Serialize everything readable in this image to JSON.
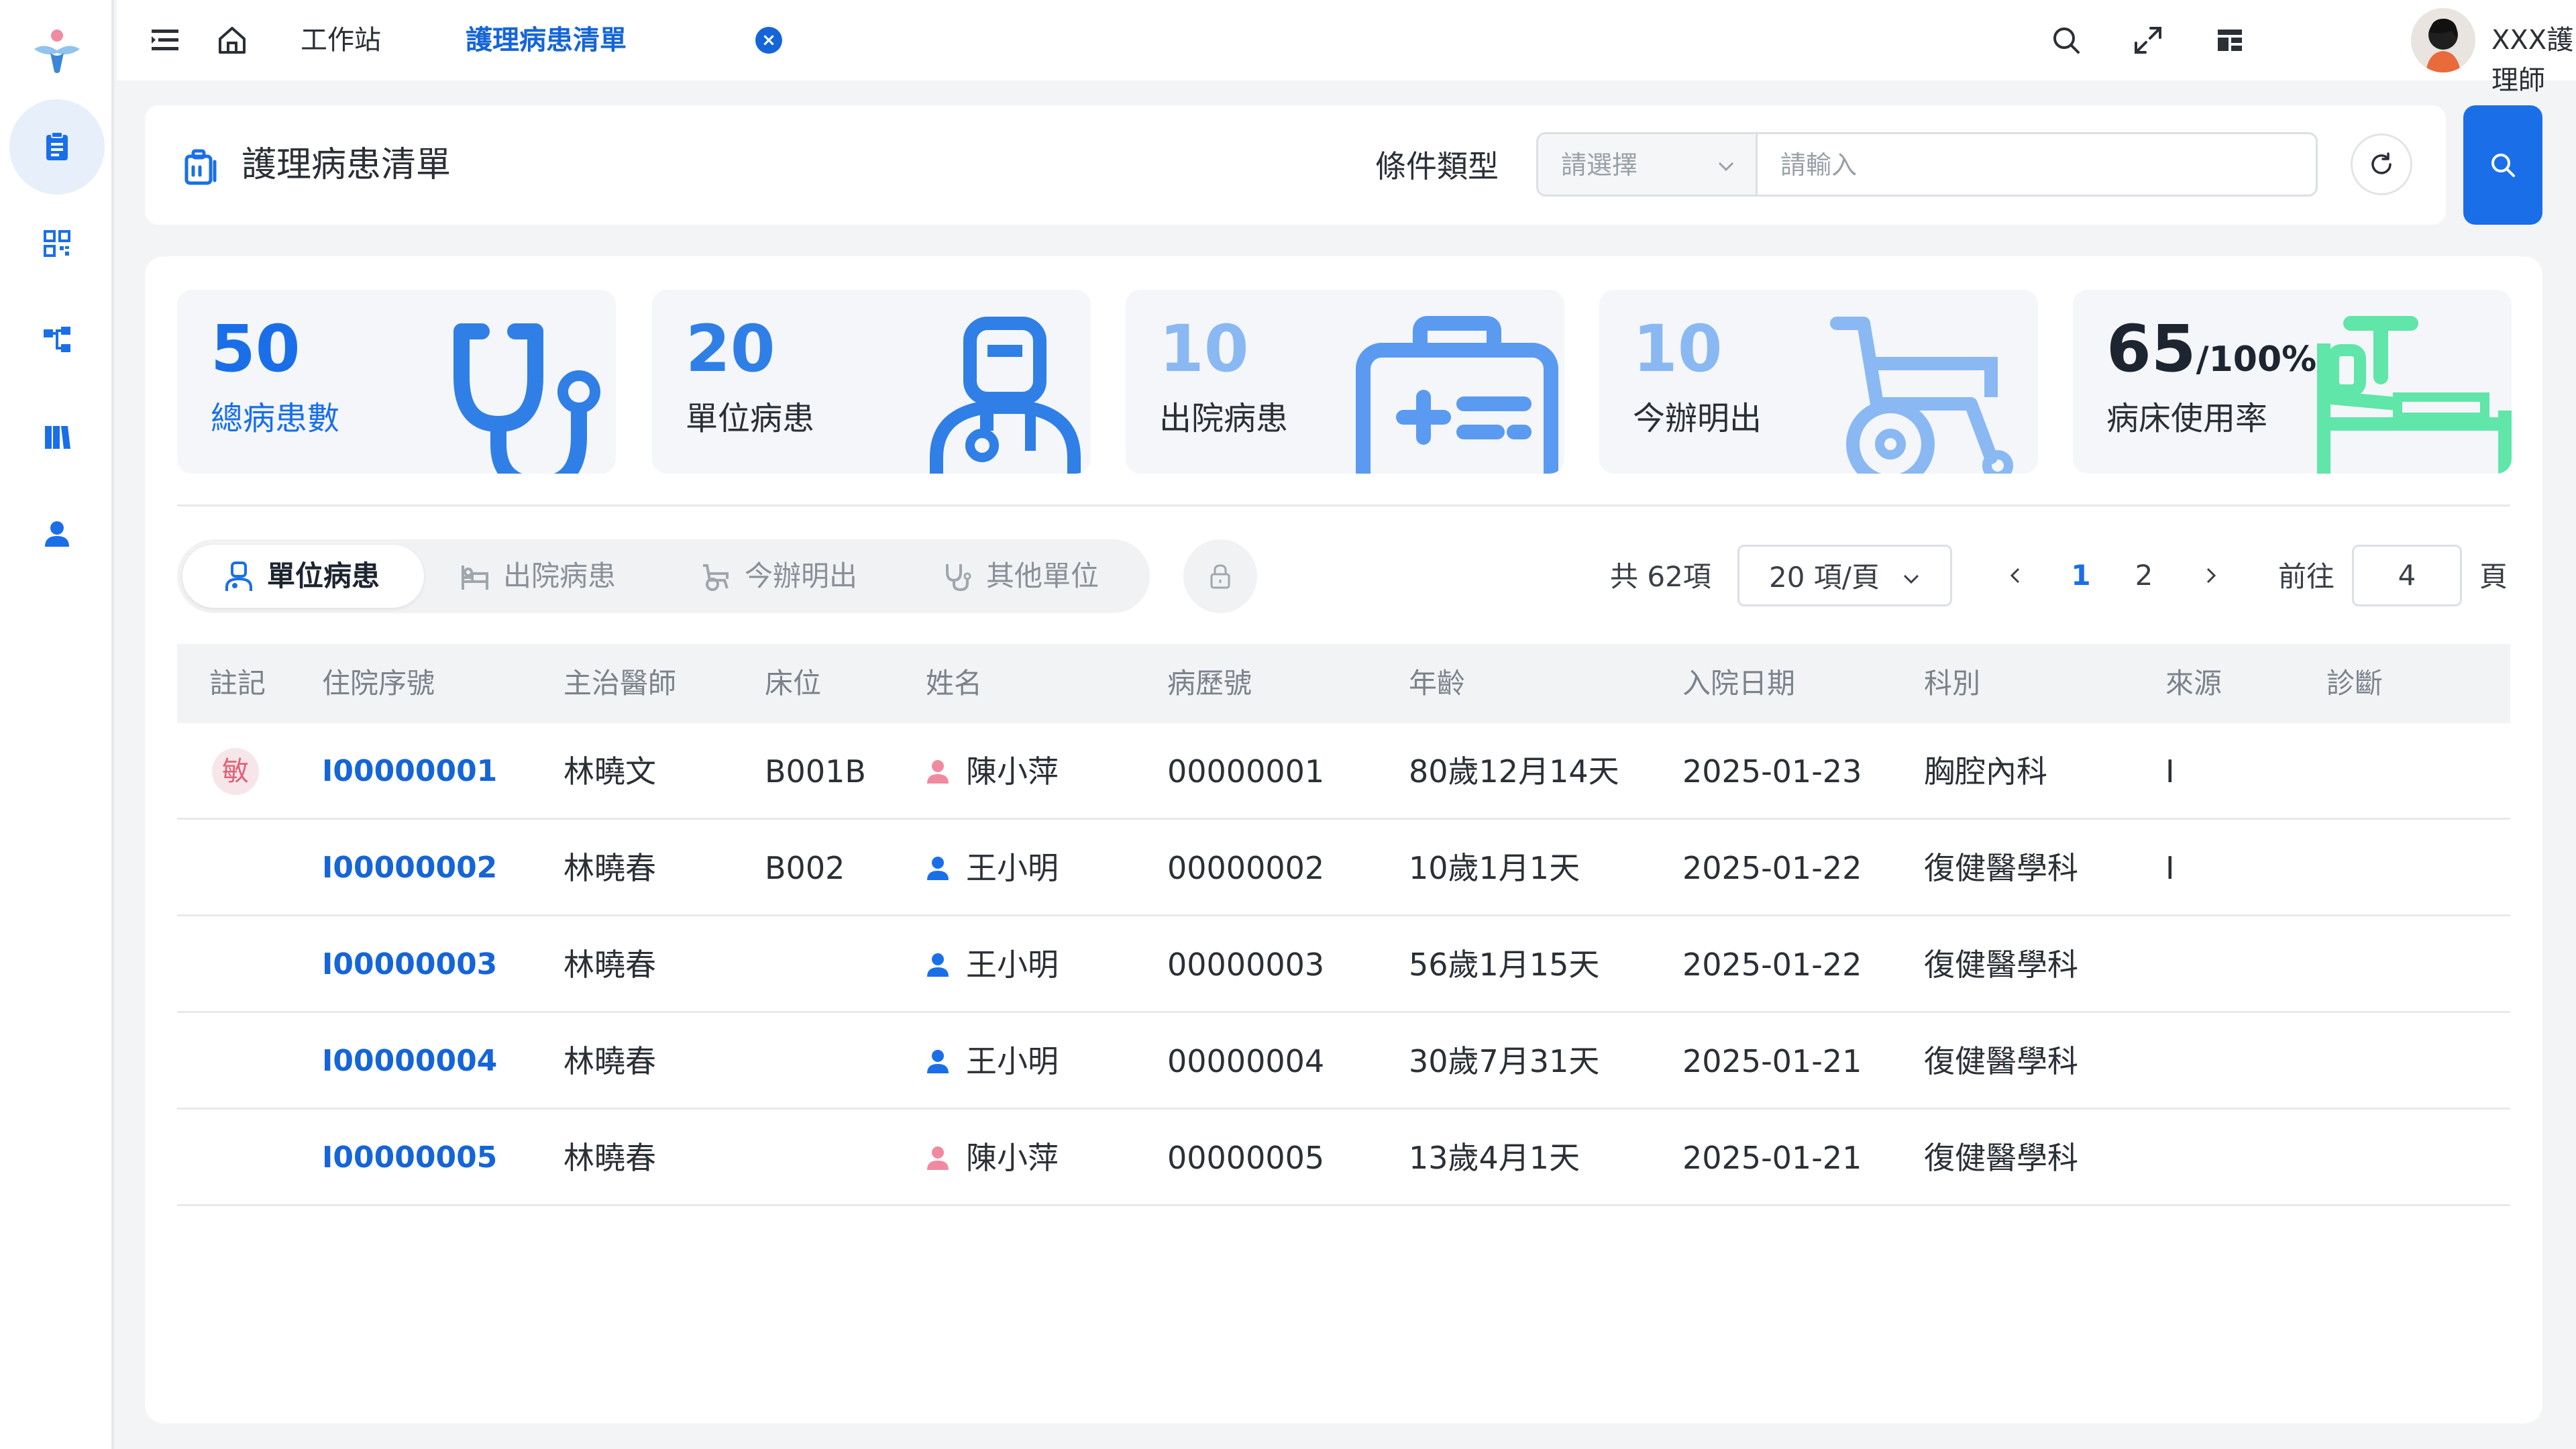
{
  "colors": {
    "primary": "#1a6fe8",
    "stat_blue": "#2f7fe6",
    "stat_light": "#8ab8f2",
    "stat_green": "#5fe6a8",
    "sensitive": "#e0627a"
  },
  "header": {
    "workstation": "工作站",
    "active_tab": "護理病患清單",
    "user_name": "XXX護理師"
  },
  "search": {
    "title": "護理病患清單",
    "condition_label": "條件類型",
    "select_placeholder": "請選擇",
    "input_placeholder": "請輸入"
  },
  "stats": [
    {
      "value": "50",
      "label": "總病患數",
      "icon": "stethoscope-icon"
    },
    {
      "value": "20",
      "label": "單位病患",
      "icon": "doctor-icon"
    },
    {
      "value": "10",
      "label": "出院病患",
      "icon": "medical-kit-icon"
    },
    {
      "value": "10",
      "label": "今辦明出",
      "icon": "wheelchair-icon"
    },
    {
      "value": "65",
      "suffix": "/100%",
      "label": "病床使用率",
      "icon": "bed-icon"
    }
  ],
  "tabs": [
    {
      "label": "單位病患",
      "active": true
    },
    {
      "label": "出院病患"
    },
    {
      "label": "今辦明出"
    },
    {
      "label": "其他單位"
    }
  ],
  "pagination": {
    "total": "共 62項",
    "page_size": "20 項/頁",
    "pages": [
      "1",
      "2"
    ],
    "current": "1",
    "goto_label": "前往",
    "goto_value": "4",
    "page_suffix": "頁"
  },
  "table": {
    "columns": [
      "註記",
      "住院序號",
      "主治醫師",
      "床位",
      "姓名",
      "病歷號",
      "年齡",
      "入院日期",
      "科別",
      "來源",
      "診斷"
    ],
    "rows": [
      {
        "tag": "敏",
        "id": "I00000001",
        "doctor": "林曉文",
        "bed": "B001B",
        "gender": "female",
        "name": "陳小萍",
        "mrn": "00000001",
        "age": "80歲12月14天",
        "date": "2025-01-23",
        "dept": "胸腔內科",
        "source": "I",
        "diag": ""
      },
      {
        "tag": "",
        "id": "I00000002",
        "doctor": "林曉春",
        "bed": "B002",
        "gender": "male",
        "name": "王小明",
        "mrn": "00000002",
        "age": "10歲1月1天",
        "date": "2025-01-22",
        "dept": "復健醫學科",
        "source": "I",
        "diag": ""
      },
      {
        "tag": "",
        "id": "I00000003",
        "doctor": "林曉春",
        "bed": "",
        "gender": "male",
        "name": "王小明",
        "mrn": "00000003",
        "age": "56歲1月15天",
        "date": "2025-01-22",
        "dept": "復健醫學科",
        "source": "",
        "diag": ""
      },
      {
        "tag": "",
        "id": "I00000004",
        "doctor": "林曉春",
        "bed": "",
        "gender": "male",
        "name": "王小明",
        "mrn": "00000004",
        "age": "30歲7月31天",
        "date": "2025-01-21",
        "dept": "復健醫學科",
        "source": "",
        "diag": ""
      },
      {
        "tag": "",
        "id": "I00000005",
        "doctor": "林曉春",
        "bed": "",
        "gender": "female",
        "name": "陳小萍",
        "mrn": "00000005",
        "age": "13歲4月1天",
        "date": "2025-01-21",
        "dept": "復健醫學科",
        "source": "",
        "diag": ""
      }
    ]
  }
}
